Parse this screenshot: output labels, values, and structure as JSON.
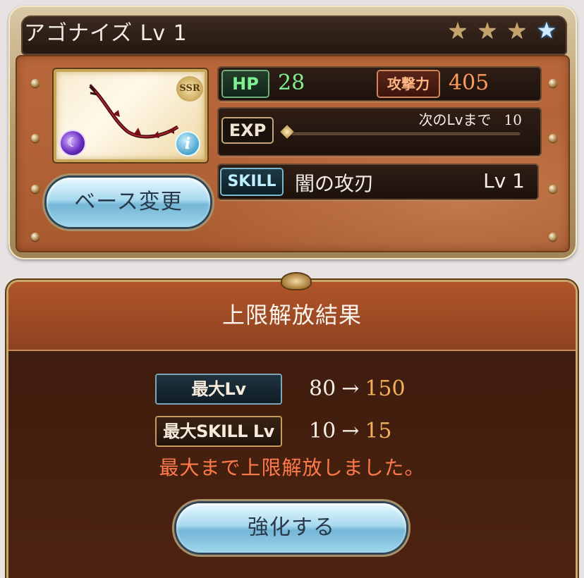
{
  "weapon": {
    "name_title": "アゴナイズ Lv 1",
    "rarity": "SSR",
    "element": "dark",
    "stars_filled": 3,
    "stars_total": 4
  },
  "base_button": {
    "label": "ベース変更"
  },
  "stats": {
    "hp_label": "HP",
    "hp_value": "28",
    "atk_label": "攻撃力",
    "atk_value": "405",
    "exp_label": "EXP",
    "exp_next_label": "次のLvまで",
    "exp_next_value": "10",
    "exp_progress": 0.0,
    "skill_label": "SKILL",
    "skill_name": "闇の攻刃",
    "skill_level": "Lv 1"
  },
  "result": {
    "title": "上限解放結果",
    "max_lv_label": "最大Lv",
    "max_lv_old": "80",
    "max_lv_new": "150",
    "max_skill_label": "最大SKILL Lv",
    "max_skill_old": "10",
    "max_skill_new": "15",
    "arrow": "→",
    "notice": "最大まで上限解放しました。"
  },
  "enhance_button": {
    "label": "強化する"
  },
  "colors": {
    "panel_brown": "#b26236",
    "hp_green": "#7ff08f",
    "atk_orange": "#ff9a5c",
    "new_value_gold": "#f1b15c",
    "notice_red": "#ff7a4a",
    "button_blue": "#a8d9ef"
  },
  "icons": [
    "star-icon",
    "blue-star-icon",
    "dark-element-icon",
    "info-icon",
    "ssr-badge"
  ]
}
